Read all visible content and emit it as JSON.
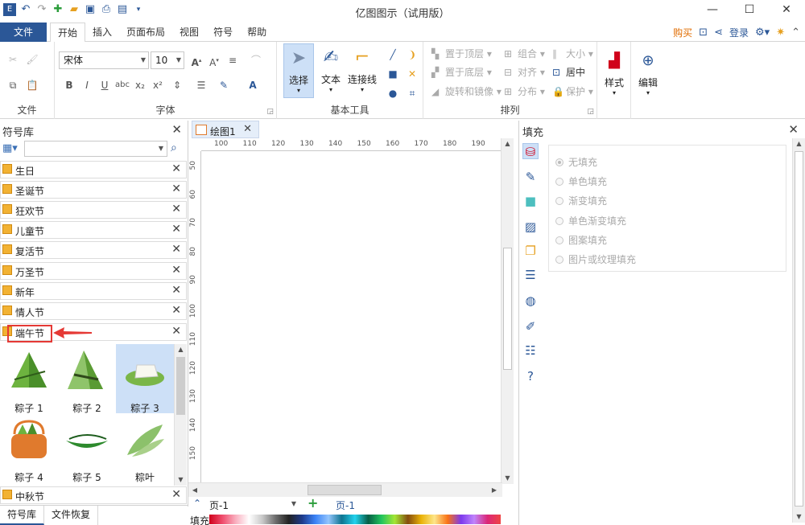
{
  "window": {
    "title": "亿图图示（试用版）"
  },
  "menu": {
    "file": "文件",
    "tabs": [
      "开始",
      "插入",
      "页面布局",
      "视图",
      "符号",
      "帮助"
    ],
    "buy": "购买",
    "login": "登录"
  },
  "ribbon": {
    "file_group": "文件",
    "font": {
      "name": "宋体",
      "size": "10",
      "label": "字体"
    },
    "basic_tools": {
      "select": "选择",
      "text": "文本",
      "connector": "连接线",
      "label": "基本工具"
    },
    "arrange": {
      "bring_front": "置于顶层",
      "send_back": "置于底层",
      "rotate_mirror": "旋转和镜像",
      "group": "组合",
      "align": "对齐",
      "distribute": "分布",
      "size": "大小",
      "center": "居中",
      "protect": "保护",
      "label": "排列"
    },
    "style": "样式",
    "edit": "编辑"
  },
  "symbol_library": {
    "title": "符号库",
    "categories": [
      "生日",
      "圣诞节",
      "狂欢节",
      "儿童节",
      "复活节",
      "万圣节",
      "新年",
      "情人节",
      "端午节"
    ],
    "shapes": [
      "粽子 1",
      "粽子 2",
      "粽子 3",
      "粽子 4",
      "粽子 5",
      "粽叶"
    ],
    "bottom_category": "中秋节",
    "bottom_tabs": [
      "符号库",
      "文件恢复"
    ]
  },
  "canvas": {
    "tab": "绘图1",
    "ruler_h": [
      "100",
      "110",
      "120",
      "130",
      "140",
      "150",
      "160",
      "170",
      "180",
      "190"
    ],
    "ruler_v": [
      "50",
      "60",
      "70",
      "80",
      "90",
      "100",
      "110",
      "120",
      "130",
      "140",
      "150"
    ],
    "page_select": "页-1",
    "page_current": "页-1",
    "fill_label": "填充"
  },
  "fill_panel": {
    "title": "填充",
    "options": [
      "无填充",
      "单色填充",
      "渐变填充",
      "单色渐变填充",
      "图案填充",
      "图片或纹理填充"
    ]
  }
}
